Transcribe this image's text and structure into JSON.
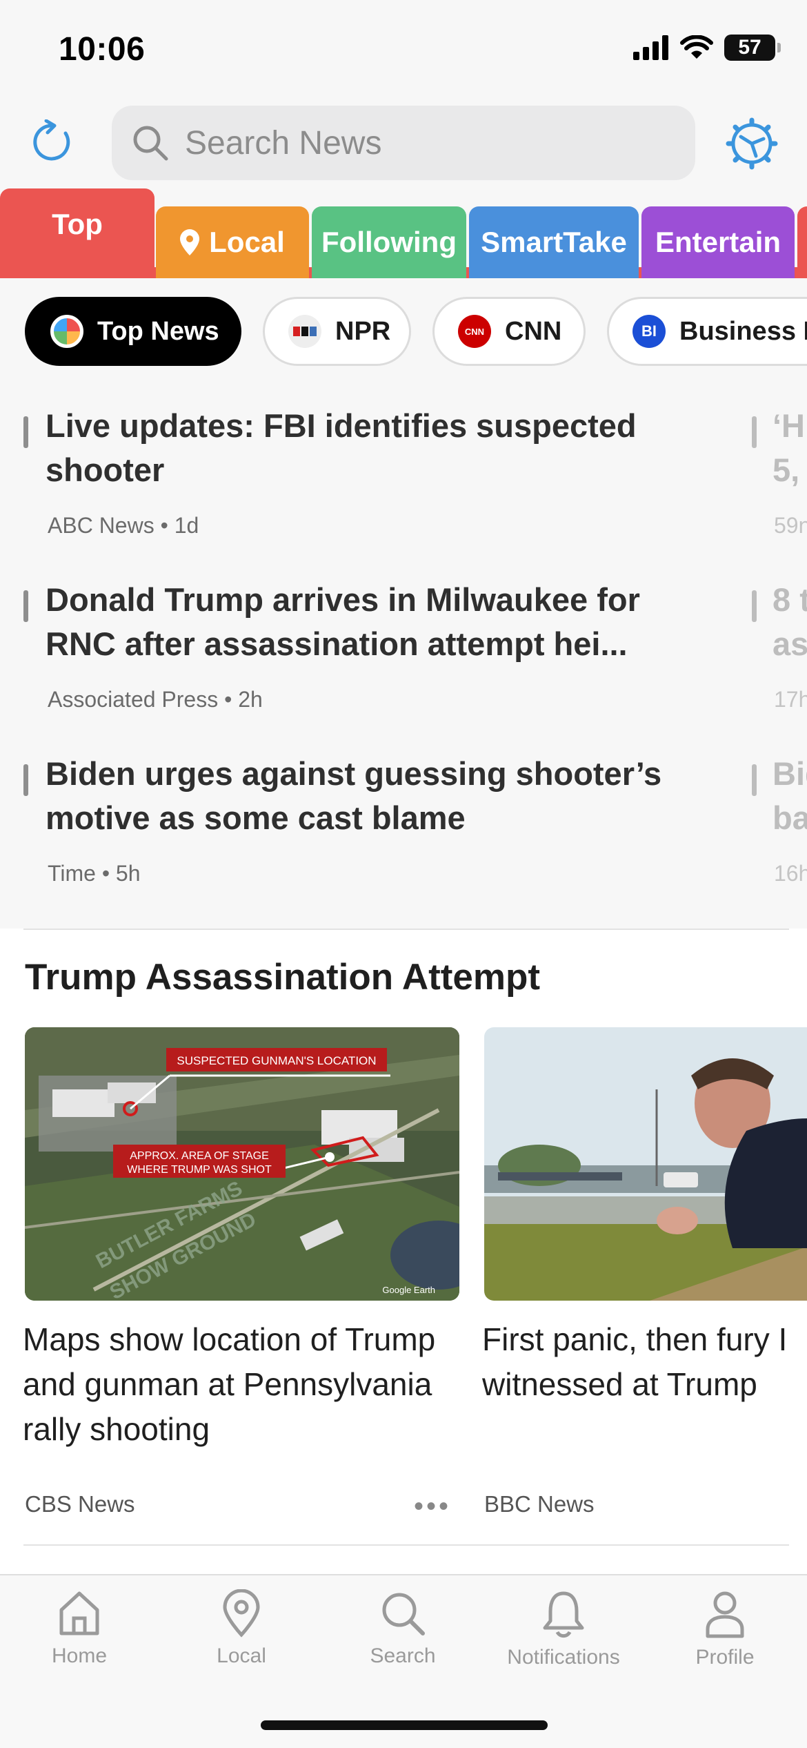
{
  "status_bar": {
    "time": "10:06",
    "battery": "57"
  },
  "search": {
    "placeholder": "Search News"
  },
  "category_tabs": [
    {
      "label": "Top",
      "color": "#eb5551"
    },
    {
      "label": "Local",
      "color": "#f0962f"
    },
    {
      "label": "Following",
      "color": "#59c283"
    },
    {
      "label": "SmartTake",
      "color": "#4a90dc"
    },
    {
      "label": "Entertain",
      "color": "#9c4fd6"
    }
  ],
  "source_pills": [
    {
      "label": "Top News",
      "active": true
    },
    {
      "label": "NPR",
      "active": false
    },
    {
      "label": "CNN",
      "active": false
    },
    {
      "label": "Business In",
      "active": false
    }
  ],
  "headlines": [
    {
      "title": "Live updates: FBI identifies suspected shooter",
      "source": "ABC News",
      "age": "1d"
    },
    {
      "title": "Donald Trump arrives in Milwaukee for RNC after assassination attempt hei...",
      "source": "Associated Press",
      "age": "2h"
    },
    {
      "title": "Biden urges against guessing shooter’s motive as some cast blame",
      "source": "Time",
      "age": "5h"
    }
  ],
  "headlines_peek": [
    {
      "line1": "‘H",
      "line2": "5,",
      "meta": "59n"
    },
    {
      "line1": "8 t",
      "line2": "as",
      "meta": "17h"
    },
    {
      "line1": "Bid",
      "line2": "ba",
      "meta": "16h"
    }
  ],
  "section": {
    "title": "Trump Assassination Attempt",
    "cards": [
      {
        "title": "Maps show location of Trump and gunman at Pennsylvania rally shooting",
        "source": "CBS News",
        "image_labels": {
          "gunman": "SUSPECTED GUNMAN'S LOCATION",
          "stage_line1": "APPROX. AREA OF STAGE",
          "stage_line2": "WHERE TRUMP WAS SHOT",
          "ground_line1": "BUTLER FARMS",
          "ground_line2": "SHOW GROUND",
          "credit": "Google Earth"
        }
      },
      {
        "title": "First panic, then fury I witnessed at Trump",
        "source": "BBC News"
      }
    ],
    "more": "•••"
  },
  "tab_bar": [
    {
      "label": "Home",
      "icon": "home-icon"
    },
    {
      "label": "Local",
      "icon": "location-pin-icon"
    },
    {
      "label": "Search",
      "icon": "search-icon"
    },
    {
      "label": "Notifications",
      "icon": "bell-icon"
    },
    {
      "label": "Profile",
      "icon": "person-icon"
    }
  ]
}
